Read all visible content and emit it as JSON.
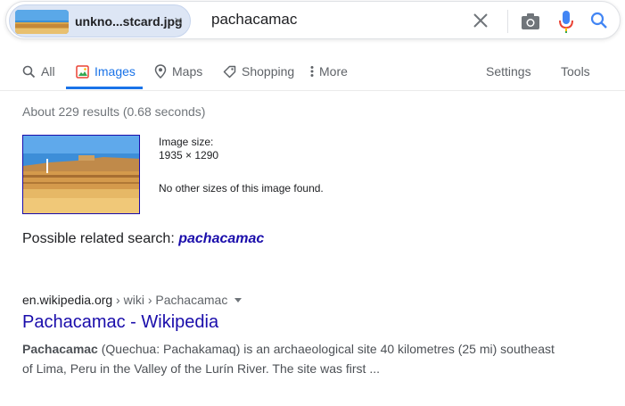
{
  "search": {
    "image_chip_name": "unkno...stcard.jpg",
    "chip_close_glyph": "×",
    "query": "pachacamac"
  },
  "tabs": [
    {
      "label": "All",
      "icon": "search-icon"
    },
    {
      "label": "Images",
      "icon": "images-icon",
      "active": true
    },
    {
      "label": "Maps",
      "icon": "map-pin-icon"
    },
    {
      "label": "Shopping",
      "icon": "tag-icon"
    },
    {
      "label": "More",
      "icon": "more-vert-icon"
    },
    {
      "label": "Settings"
    },
    {
      "label": "Tools"
    }
  ],
  "stats": "About 229 results (0.68 seconds)",
  "image_info": {
    "size_label": "Image size:",
    "size_value": "1935 × 1290",
    "other_sizes": "No other sizes of this image found."
  },
  "related": {
    "label": "Possible related search:",
    "term": "pachacamac"
  },
  "result": {
    "domain": "en.wikipedia.org",
    "path": " › wiki › Pachacamac",
    "title": "Pachacamac - Wikipedia",
    "snippet_bold": "Pachacamac",
    "snippet_rest": " (Quechua: Pachakamaq) is an archaeological site 40 kilometres (25 mi) southeast of Lima, Peru in the Valley of the Lurín River. The site was first ..."
  },
  "colors": {
    "link_blue": "#1a0dab",
    "active_tab": "#1a73e8",
    "mic_blue": "#4285f4",
    "mic_red": "#ea4335"
  }
}
